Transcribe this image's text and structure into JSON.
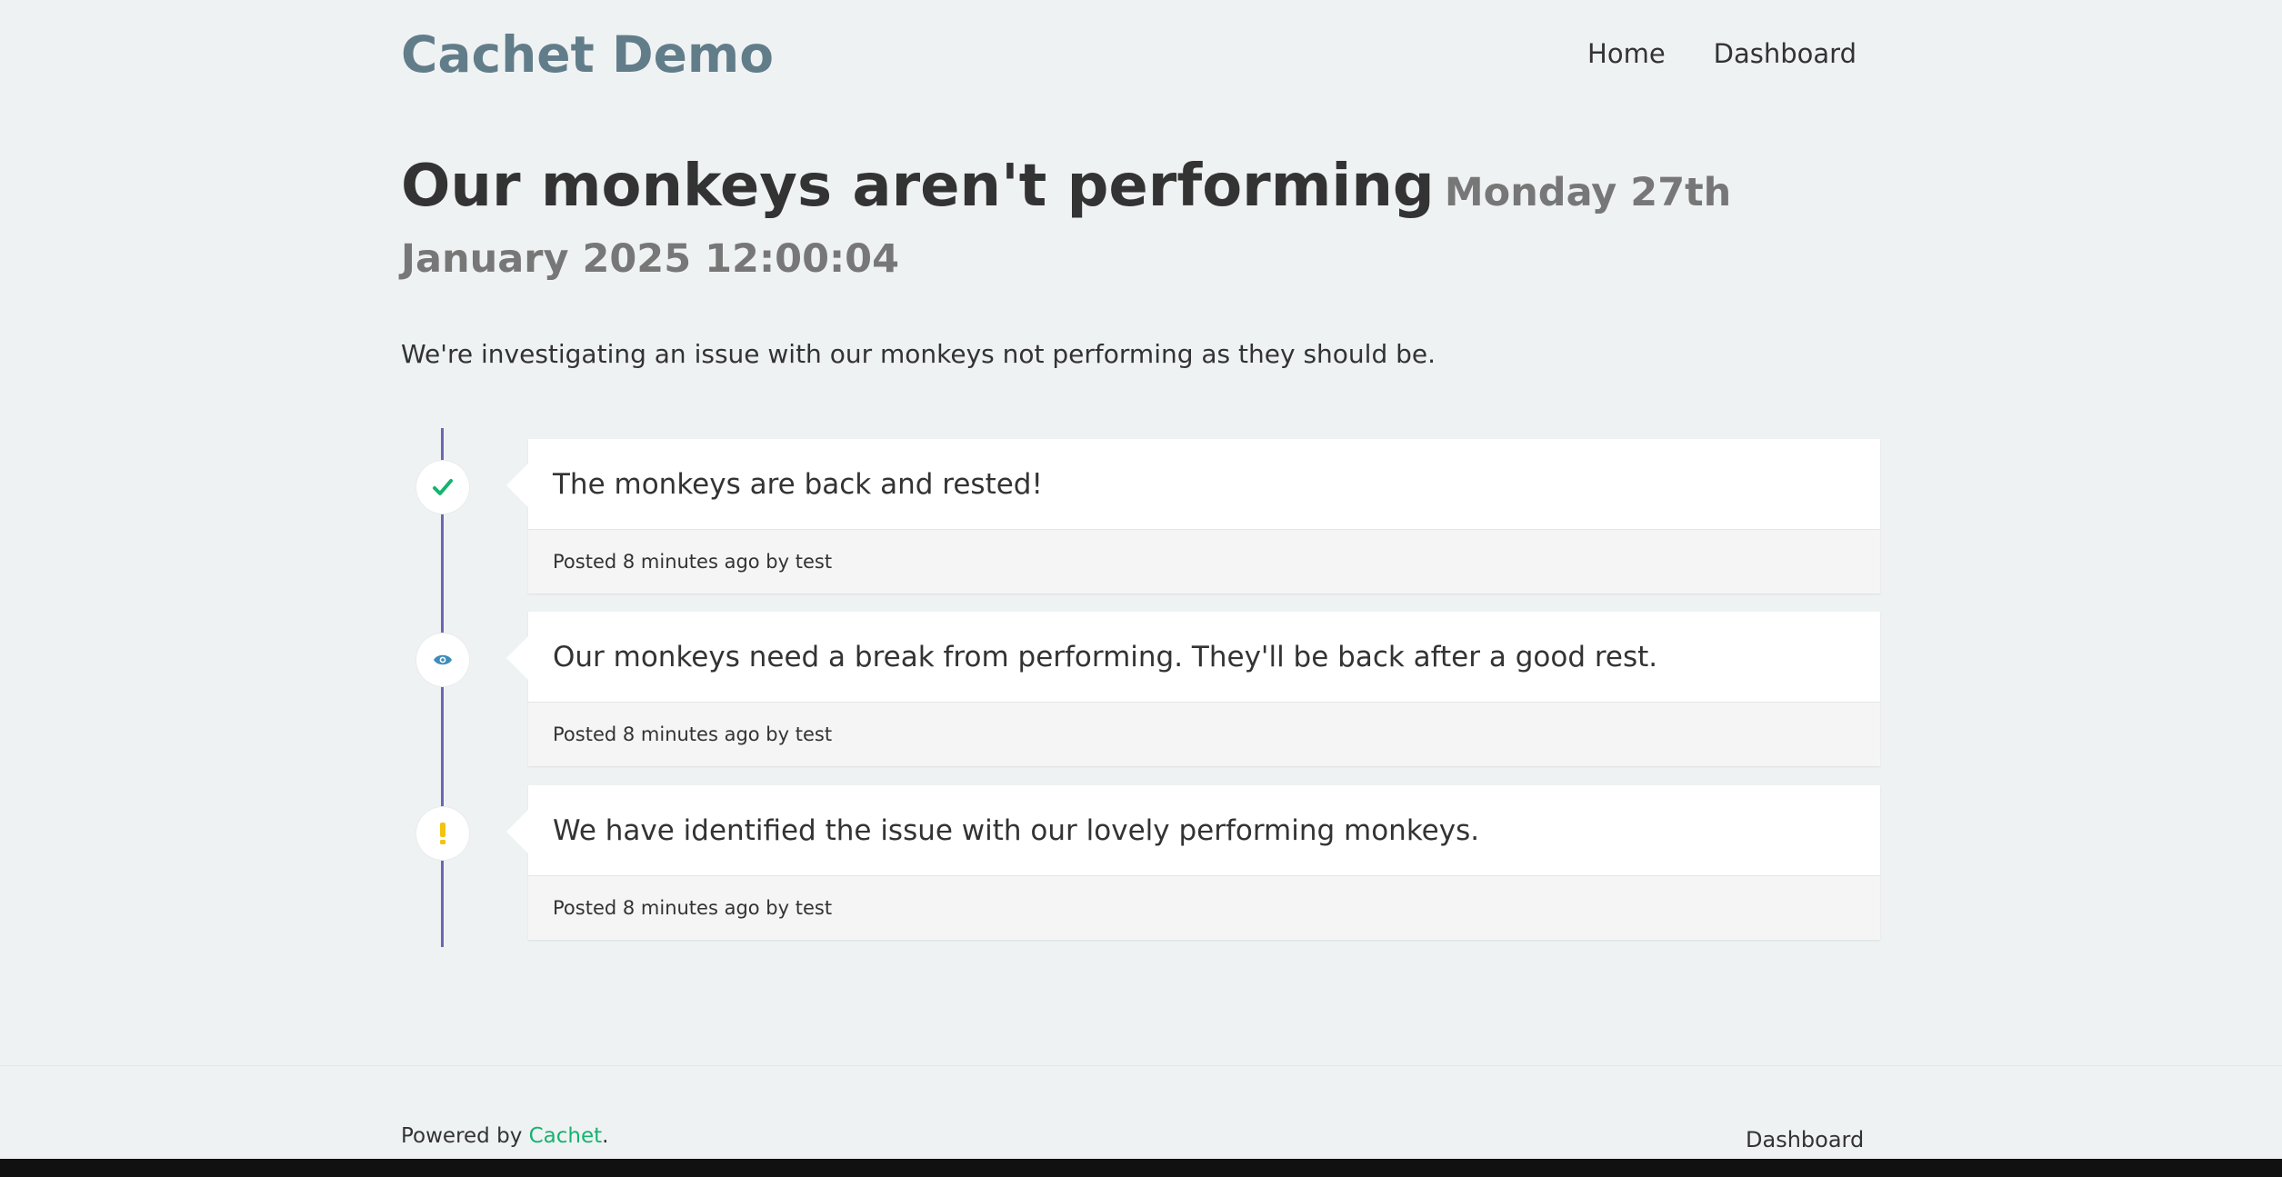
{
  "header": {
    "brand": "Cachet Demo",
    "nav": [
      {
        "label": "Home"
      },
      {
        "label": "Dashboard"
      }
    ]
  },
  "incident": {
    "title": "Our monkeys aren't performing",
    "date": "Monday 27th January 2025 12:00:04",
    "message": "We're investigating an issue with our monkeys not performing as they should be."
  },
  "updates": [
    {
      "status_icon": "check-icon",
      "status_color": "#16b36f",
      "message": "The monkeys are back and rested!",
      "posted": "Posted 8 minutes ago by test"
    },
    {
      "status_icon": "eye-icon",
      "status_color": "#3c8dbc",
      "message": "Our monkeys need a break from performing. They'll be back after a good rest.",
      "posted": "Posted 8 minutes ago by test"
    },
    {
      "status_icon": "exclamation-icon",
      "status_color": "#f1c40f",
      "message": "We have identified the issue with our lovely performing monkeys.",
      "posted": "Posted 8 minutes ago by test"
    }
  ],
  "footer": {
    "powered_prefix": "Powered by ",
    "powered_link": "Cachet",
    "powered_suffix": ".",
    "dashboard_link": "Dashboard"
  },
  "colors": {
    "accent": "#627d8a",
    "timeline": "#6b67b4",
    "link": "#16b36f"
  }
}
